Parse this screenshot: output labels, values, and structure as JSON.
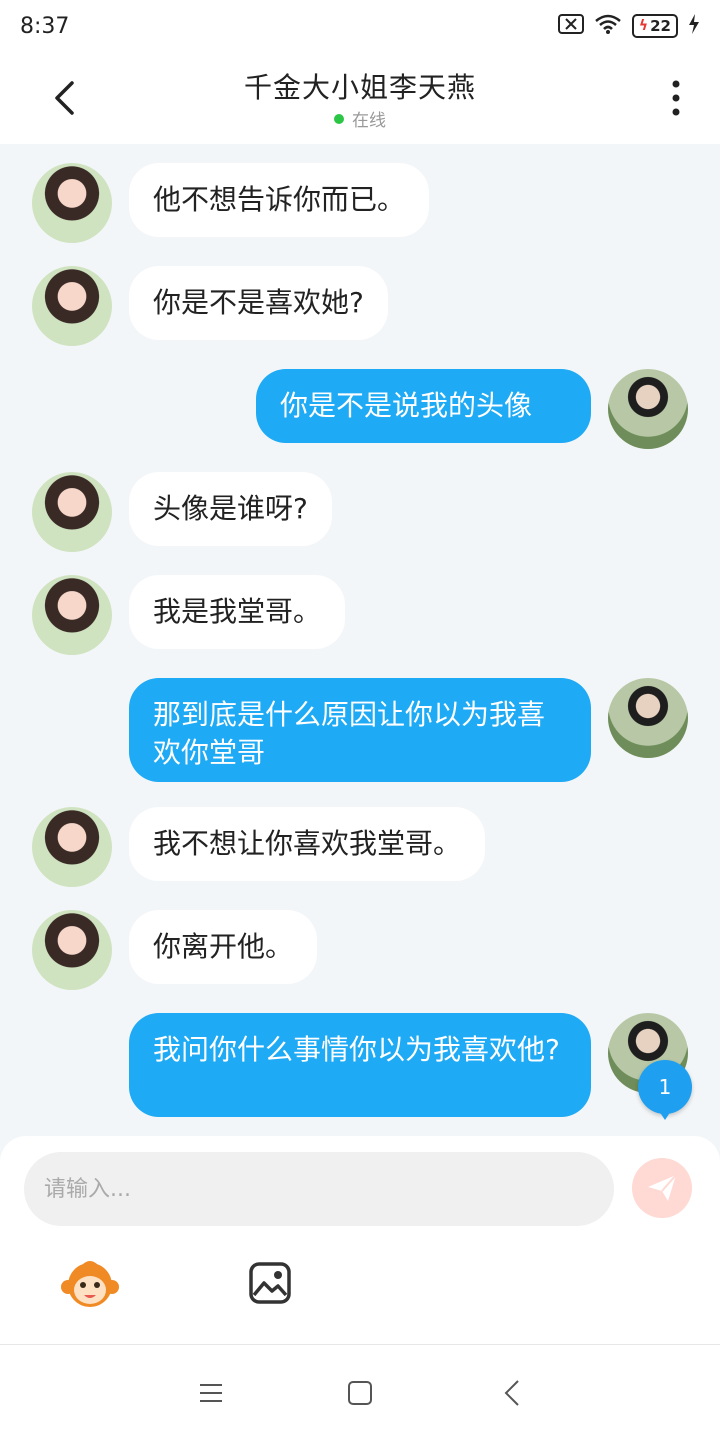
{
  "status_bar": {
    "time": "8:37",
    "battery": "22"
  },
  "header": {
    "title": "千金大小姐李天燕",
    "status": "在线"
  },
  "messages": [
    {
      "side": "left",
      "text": "他不想告诉你而已。"
    },
    {
      "side": "left",
      "text": "你是不是喜欢她?"
    },
    {
      "side": "right",
      "text": "你是不是说我的头像"
    },
    {
      "side": "left",
      "text": "头像是谁呀?"
    },
    {
      "side": "left",
      "text": "我是我堂哥。"
    },
    {
      "side": "right",
      "text": "那到底是什么原因让你以为我喜欢你堂哥"
    },
    {
      "side": "left",
      "text": "我不想让你喜欢我堂哥。"
    },
    {
      "side": "left",
      "text": "你离开他。"
    },
    {
      "side": "right",
      "text": "我问你什么事情你以为我喜欢他?"
    }
  ],
  "unread_badge": "1",
  "composer": {
    "placeholder": "请输入..."
  },
  "icons": {
    "back": "chevron-left-icon",
    "more": "more-vertical-icon",
    "send": "paper-plane-icon",
    "emoji": "monkey-emoji-icon",
    "image": "image-icon",
    "nav_menu": "menu-icon",
    "nav_home": "square-icon",
    "nav_back": "chevron-left-icon"
  },
  "colors": {
    "accent": "#1eaaf4",
    "online": "#2bc646",
    "background": "#f3f6f8"
  }
}
